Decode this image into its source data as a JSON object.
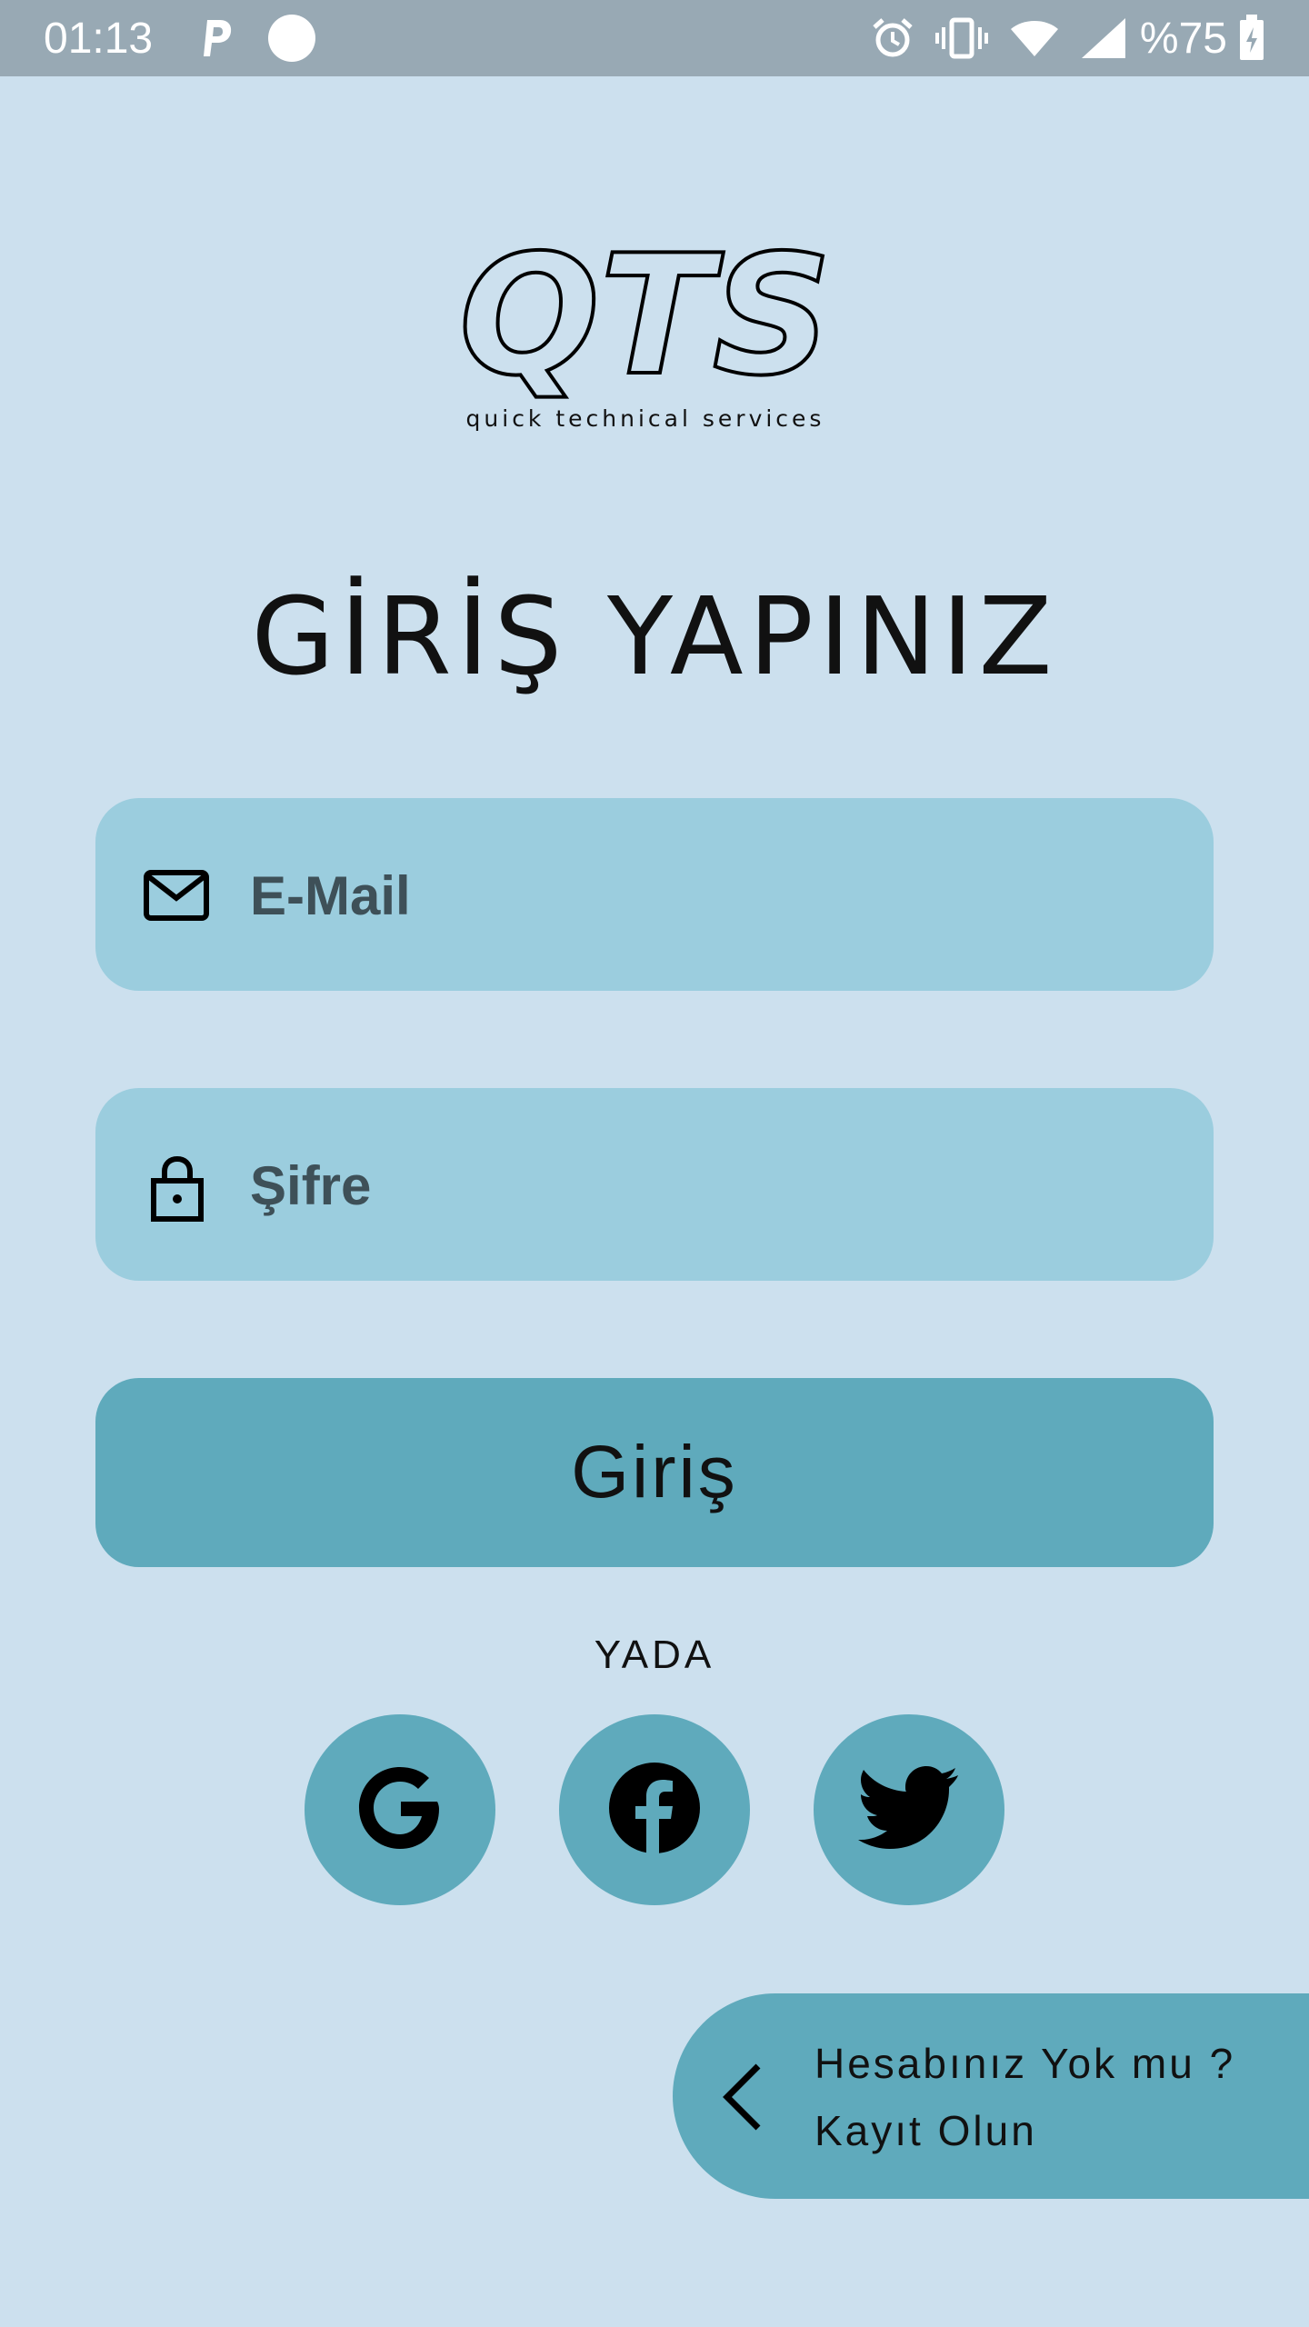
{
  "status_bar": {
    "time": "01:13",
    "battery_percent": "%75",
    "left_icons": [
      "p-notification-icon",
      "circle-notification-icon"
    ],
    "right_icons": [
      "alarm-icon",
      "vibrate-icon",
      "wifi-icon",
      "signal-icon",
      "battery-charging-icon"
    ]
  },
  "logo": {
    "wordmark": "QTS",
    "tagline": "quick technical services"
  },
  "title": "GİRİŞ YAPINIZ",
  "form": {
    "email_placeholder": "E-Mail",
    "email_icon": "mail-icon",
    "password_placeholder": "Şifre",
    "password_icon": "lock-icon",
    "login_label": "Giriş"
  },
  "divider_text": "YADA",
  "social_buttons": [
    "google",
    "facebook",
    "twitter"
  ],
  "register": {
    "line1": "Hesabınız Yok mu ?",
    "line2": "Kayıt Olun"
  },
  "colors": {
    "background": "#cce0ee",
    "status_bar": "#98a9b4",
    "input_fill": "#9bcdde",
    "accent": "#5faabc"
  }
}
